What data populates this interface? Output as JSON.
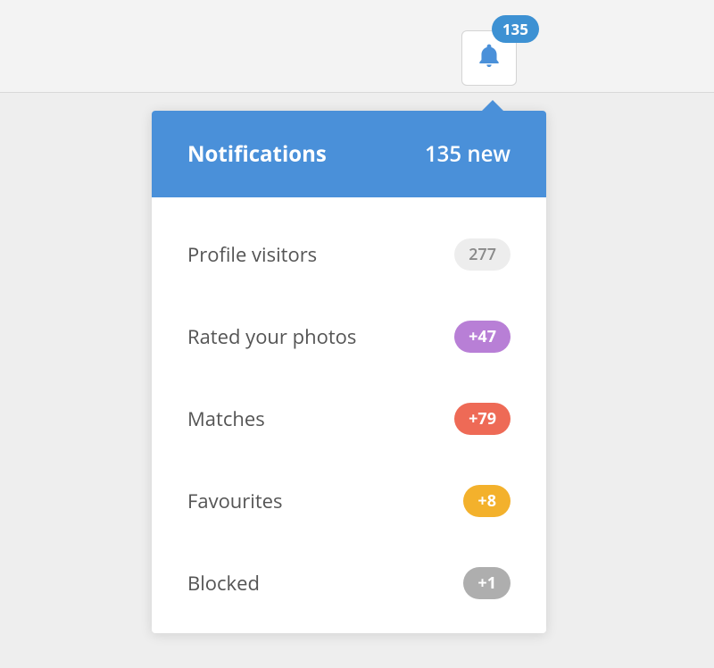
{
  "bell": {
    "badge": "135"
  },
  "dropdown": {
    "header": {
      "title": "Notifications",
      "count": "135 new"
    },
    "items": [
      {
        "label": "Profile visitors",
        "badge": "277",
        "badgeClass": "badge-gray"
      },
      {
        "label": "Rated your photos",
        "badge": "+47",
        "badgeClass": "badge-purple"
      },
      {
        "label": "Matches",
        "badge": "+79",
        "badgeClass": "badge-red"
      },
      {
        "label": "Favourites",
        "badge": "+8",
        "badgeClass": "badge-amber"
      },
      {
        "label": "Blocked",
        "badge": "+1",
        "badgeClass": "badge-darkgray"
      }
    ]
  }
}
